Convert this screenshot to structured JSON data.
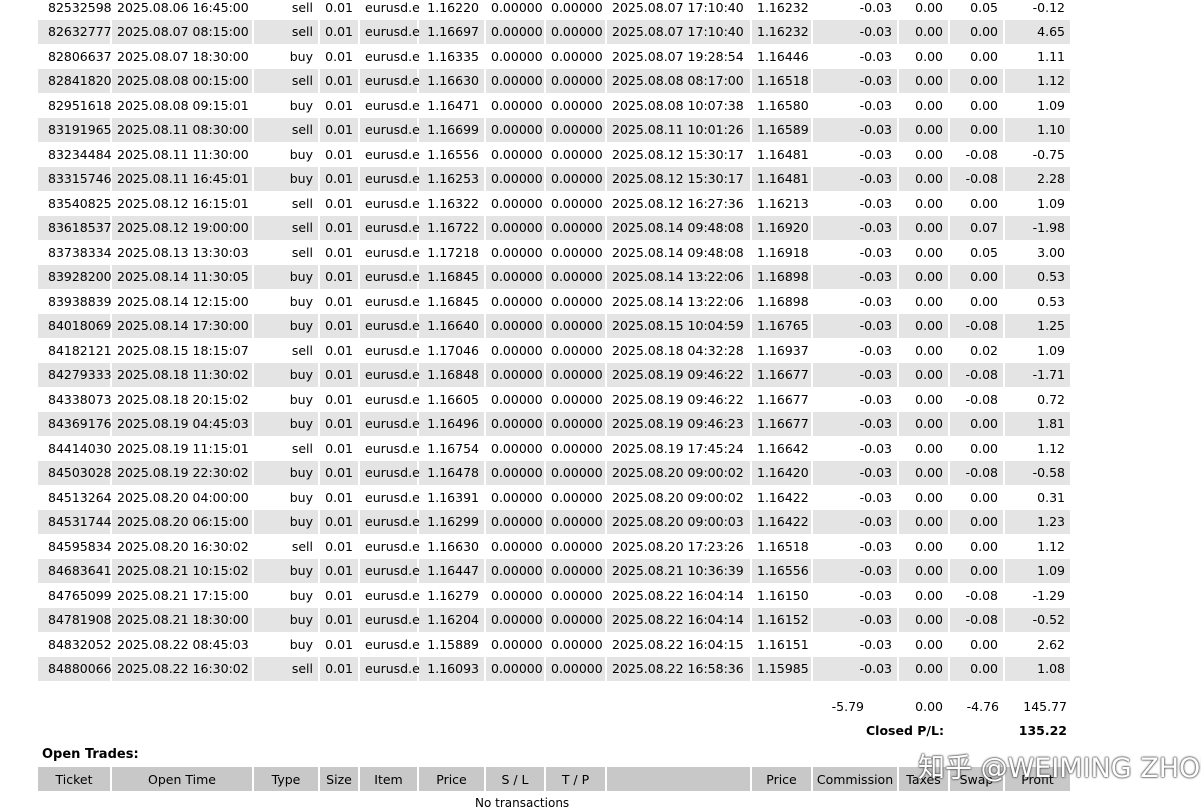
{
  "closed_trades": {
    "rows": [
      [
        "82532598",
        "2025.08.06 16:45:00",
        "sell",
        "0.01",
        "eurusd.e",
        "1.16220",
        "0.00000",
        "0.00000",
        "2025.08.07 17:10:40",
        "1.16232",
        "-0.03",
        "0.00",
        "0.05",
        "-0.12"
      ],
      [
        "82632777",
        "2025.08.07 08:15:00",
        "sell",
        "0.01",
        "eurusd.e",
        "1.16697",
        "0.00000",
        "0.00000",
        "2025.08.07 17:10:40",
        "1.16232",
        "-0.03",
        "0.00",
        "0.00",
        "4.65"
      ],
      [
        "82806637",
        "2025.08.07 18:30:00",
        "buy",
        "0.01",
        "eurusd.e",
        "1.16335",
        "0.00000",
        "0.00000",
        "2025.08.07 19:28:54",
        "1.16446",
        "-0.03",
        "0.00",
        "0.00",
        "1.11"
      ],
      [
        "82841820",
        "2025.08.08 00:15:00",
        "sell",
        "0.01",
        "eurusd.e",
        "1.16630",
        "0.00000",
        "0.00000",
        "2025.08.08 08:17:00",
        "1.16518",
        "-0.03",
        "0.00",
        "0.00",
        "1.12"
      ],
      [
        "82951618",
        "2025.08.08 09:15:01",
        "buy",
        "0.01",
        "eurusd.e",
        "1.16471",
        "0.00000",
        "0.00000",
        "2025.08.08 10:07:38",
        "1.16580",
        "-0.03",
        "0.00",
        "0.00",
        "1.09"
      ],
      [
        "83191965",
        "2025.08.11 08:30:00",
        "sell",
        "0.01",
        "eurusd.e",
        "1.16699",
        "0.00000",
        "0.00000",
        "2025.08.11 10:01:26",
        "1.16589",
        "-0.03",
        "0.00",
        "0.00",
        "1.10"
      ],
      [
        "83234484",
        "2025.08.11 11:30:00",
        "buy",
        "0.01",
        "eurusd.e",
        "1.16556",
        "0.00000",
        "0.00000",
        "2025.08.12 15:30:17",
        "1.16481",
        "-0.03",
        "0.00",
        "-0.08",
        "-0.75"
      ],
      [
        "83315746",
        "2025.08.11 16:45:01",
        "buy",
        "0.01",
        "eurusd.e",
        "1.16253",
        "0.00000",
        "0.00000",
        "2025.08.12 15:30:17",
        "1.16481",
        "-0.03",
        "0.00",
        "-0.08",
        "2.28"
      ],
      [
        "83540825",
        "2025.08.12 16:15:01",
        "sell",
        "0.01",
        "eurusd.e",
        "1.16322",
        "0.00000",
        "0.00000",
        "2025.08.12 16:27:36",
        "1.16213",
        "-0.03",
        "0.00",
        "0.00",
        "1.09"
      ],
      [
        "83618537",
        "2025.08.12 19:00:00",
        "sell",
        "0.01",
        "eurusd.e",
        "1.16722",
        "0.00000",
        "0.00000",
        "2025.08.14 09:48:08",
        "1.16920",
        "-0.03",
        "0.00",
        "0.07",
        "-1.98"
      ],
      [
        "83738334",
        "2025.08.13 13:30:03",
        "sell",
        "0.01",
        "eurusd.e",
        "1.17218",
        "0.00000",
        "0.00000",
        "2025.08.14 09:48:08",
        "1.16918",
        "-0.03",
        "0.00",
        "0.05",
        "3.00"
      ],
      [
        "83928200",
        "2025.08.14 11:30:05",
        "buy",
        "0.01",
        "eurusd.e",
        "1.16845",
        "0.00000",
        "0.00000",
        "2025.08.14 13:22:06",
        "1.16898",
        "-0.03",
        "0.00",
        "0.00",
        "0.53"
      ],
      [
        "83938839",
        "2025.08.14 12:15:00",
        "buy",
        "0.01",
        "eurusd.e",
        "1.16845",
        "0.00000",
        "0.00000",
        "2025.08.14 13:22:06",
        "1.16898",
        "-0.03",
        "0.00",
        "0.00",
        "0.53"
      ],
      [
        "84018069",
        "2025.08.14 17:30:00",
        "buy",
        "0.01",
        "eurusd.e",
        "1.16640",
        "0.00000",
        "0.00000",
        "2025.08.15 10:04:59",
        "1.16765",
        "-0.03",
        "0.00",
        "-0.08",
        "1.25"
      ],
      [
        "84182121",
        "2025.08.15 18:15:07",
        "sell",
        "0.01",
        "eurusd.e",
        "1.17046",
        "0.00000",
        "0.00000",
        "2025.08.18 04:32:28",
        "1.16937",
        "-0.03",
        "0.00",
        "0.02",
        "1.09"
      ],
      [
        "84279333",
        "2025.08.18 11:30:02",
        "buy",
        "0.01",
        "eurusd.e",
        "1.16848",
        "0.00000",
        "0.00000",
        "2025.08.19 09:46:22",
        "1.16677",
        "-0.03",
        "0.00",
        "-0.08",
        "-1.71"
      ],
      [
        "84338073",
        "2025.08.18 20:15:02",
        "buy",
        "0.01",
        "eurusd.e",
        "1.16605",
        "0.00000",
        "0.00000",
        "2025.08.19 09:46:22",
        "1.16677",
        "-0.03",
        "0.00",
        "-0.08",
        "0.72"
      ],
      [
        "84369176",
        "2025.08.19 04:45:03",
        "buy",
        "0.01",
        "eurusd.e",
        "1.16496",
        "0.00000",
        "0.00000",
        "2025.08.19 09:46:23",
        "1.16677",
        "-0.03",
        "0.00",
        "0.00",
        "1.81"
      ],
      [
        "84414030",
        "2025.08.19 11:15:01",
        "sell",
        "0.01",
        "eurusd.e",
        "1.16754",
        "0.00000",
        "0.00000",
        "2025.08.19 17:45:24",
        "1.16642",
        "-0.03",
        "0.00",
        "0.00",
        "1.12"
      ],
      [
        "84503028",
        "2025.08.19 22:30:02",
        "buy",
        "0.01",
        "eurusd.e",
        "1.16478",
        "0.00000",
        "0.00000",
        "2025.08.20 09:00:02",
        "1.16420",
        "-0.03",
        "0.00",
        "-0.08",
        "-0.58"
      ],
      [
        "84513264",
        "2025.08.20 04:00:00",
        "buy",
        "0.01",
        "eurusd.e",
        "1.16391",
        "0.00000",
        "0.00000",
        "2025.08.20 09:00:02",
        "1.16422",
        "-0.03",
        "0.00",
        "0.00",
        "0.31"
      ],
      [
        "84531744",
        "2025.08.20 06:15:00",
        "buy",
        "0.01",
        "eurusd.e",
        "1.16299",
        "0.00000",
        "0.00000",
        "2025.08.20 09:00:03",
        "1.16422",
        "-0.03",
        "0.00",
        "0.00",
        "1.23"
      ],
      [
        "84595834",
        "2025.08.20 16:30:02",
        "sell",
        "0.01",
        "eurusd.e",
        "1.16630",
        "0.00000",
        "0.00000",
        "2025.08.20 17:23:26",
        "1.16518",
        "-0.03",
        "0.00",
        "0.00",
        "1.12"
      ],
      [
        "84683641",
        "2025.08.21 10:15:02",
        "buy",
        "0.01",
        "eurusd.e",
        "1.16447",
        "0.00000",
        "0.00000",
        "2025.08.21 10:36:39",
        "1.16556",
        "-0.03",
        "0.00",
        "0.00",
        "1.09"
      ],
      [
        "84765099",
        "2025.08.21 17:15:00",
        "buy",
        "0.01",
        "eurusd.e",
        "1.16279",
        "0.00000",
        "0.00000",
        "2025.08.22 16:04:14",
        "1.16150",
        "-0.03",
        "0.00",
        "-0.08",
        "-1.29"
      ],
      [
        "84781908",
        "2025.08.21 18:30:00",
        "buy",
        "0.01",
        "eurusd.e",
        "1.16204",
        "0.00000",
        "0.00000",
        "2025.08.22 16:04:14",
        "1.16152",
        "-0.03",
        "0.00",
        "-0.08",
        "-0.52"
      ],
      [
        "84832052",
        "2025.08.22 08:45:03",
        "buy",
        "0.01",
        "eurusd.e",
        "1.15889",
        "0.00000",
        "0.00000",
        "2025.08.22 16:04:15",
        "1.16151",
        "-0.03",
        "0.00",
        "0.00",
        "2.62"
      ],
      [
        "84880066",
        "2025.08.22 16:30:02",
        "sell",
        "0.01",
        "eurusd.e",
        "1.16093",
        "0.00000",
        "0.00000",
        "2025.08.22 16:58:36",
        "1.15985",
        "-0.03",
        "0.00",
        "0.00",
        "1.08"
      ]
    ],
    "totals": {
      "commission": "-5.79",
      "taxes": "0.00",
      "swap": "-4.76",
      "profit": "145.77"
    },
    "closed_pl_label": "Closed P/L:",
    "closed_pl_value": "135.22"
  },
  "open_trades": {
    "title": "Open Trades:",
    "headers": [
      "Ticket",
      "Open Time",
      "Type",
      "Size",
      "Item",
      "Price",
      "S / L",
      "T / P",
      "",
      "Price",
      "Commission",
      "Taxes",
      "Swap",
      "Profit"
    ],
    "empty_text": "No transactions"
  },
  "watermark": "知乎 @WEIMING ZHOU",
  "colors": {
    "row_alt": "#e4e4e4",
    "header_bg": "#c8c8c8"
  }
}
